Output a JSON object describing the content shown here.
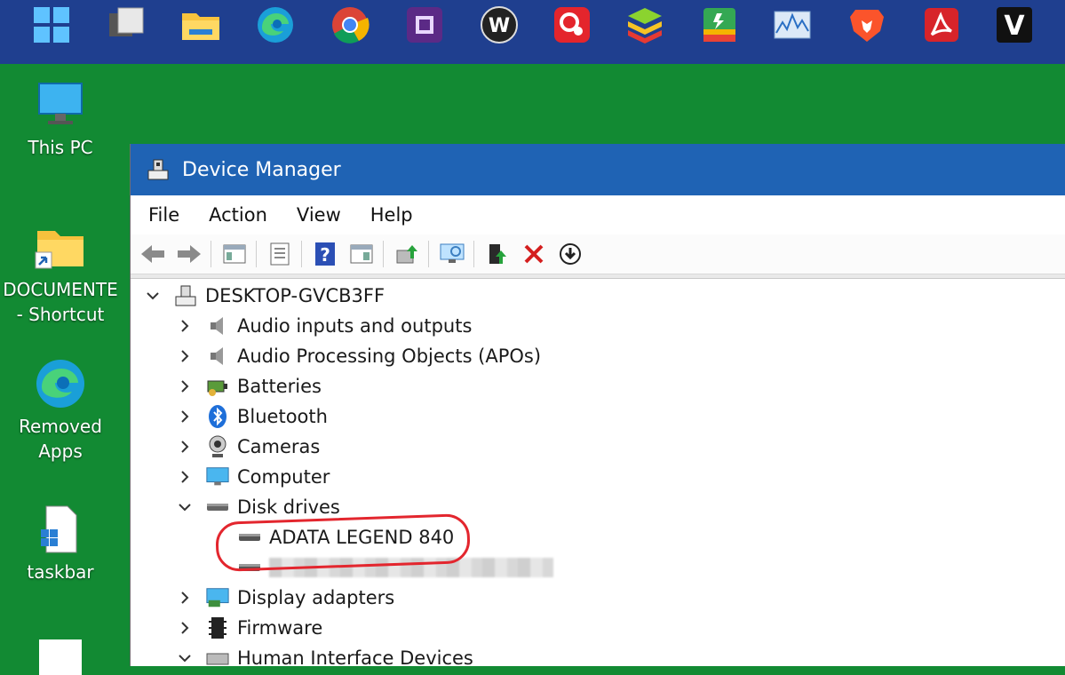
{
  "taskbar": {
    "icons": [
      "start-icon",
      "task-view-icon",
      "file-explorer-icon",
      "edge-icon",
      "chrome-icon",
      "cpu-z-icon",
      "wise-icon",
      "red-app-icon",
      "bluestacks-icon",
      "green-app-icon",
      "resource-monitor-icon",
      "brave-icon",
      "acrobat-icon",
      "v-app-icon"
    ],
    "v_letter": "V",
    "w_letter": "W"
  },
  "desktop": {
    "icons": [
      {
        "label": "This PC",
        "icon": "this-pc-icon"
      },
      {
        "label": "DOCUMENTE\n- Shortcut",
        "icon": "folder-shortcut-icon"
      },
      {
        "label": "Removed\nApps",
        "icon": "edge-icon"
      },
      {
        "label": "taskbar",
        "icon": "document-icon"
      }
    ]
  },
  "window": {
    "title": "Device Manager",
    "menu": [
      "File",
      "Action",
      "View",
      "Help"
    ],
    "toolbar_help_glyph": "?"
  },
  "tree": {
    "root": "DESKTOP-GVCB3FF",
    "items": [
      {
        "label": "Audio inputs and outputs",
        "icon": "speaker-icon",
        "expanded": false
      },
      {
        "label": "Audio Processing Objects (APOs)",
        "icon": "speaker-icon",
        "expanded": false
      },
      {
        "label": "Batteries",
        "icon": "battery-icon",
        "expanded": false
      },
      {
        "label": "Bluetooth",
        "icon": "bluetooth-icon",
        "expanded": false
      },
      {
        "label": "Cameras",
        "icon": "webcam-icon",
        "expanded": false
      },
      {
        "label": "Computer",
        "icon": "monitor-icon",
        "expanded": false
      },
      {
        "label": "Disk drives",
        "icon": "disk-drive-icon",
        "expanded": true
      },
      {
        "label": "Display adapters",
        "icon": "display-adapter-icon",
        "expanded": false
      },
      {
        "label": "Firmware",
        "icon": "firmware-icon",
        "expanded": false
      },
      {
        "label": "Human Interface Devices",
        "icon": "hid-icon",
        "expanded": false
      }
    ],
    "disk_children": [
      "ADATA LEGEND 840",
      ""
    ]
  },
  "colors": {
    "desktop": "#128a33",
    "taskbar": "#1f3f8f",
    "titlebar": "#1f63b4",
    "annotation": "#e3262e"
  }
}
